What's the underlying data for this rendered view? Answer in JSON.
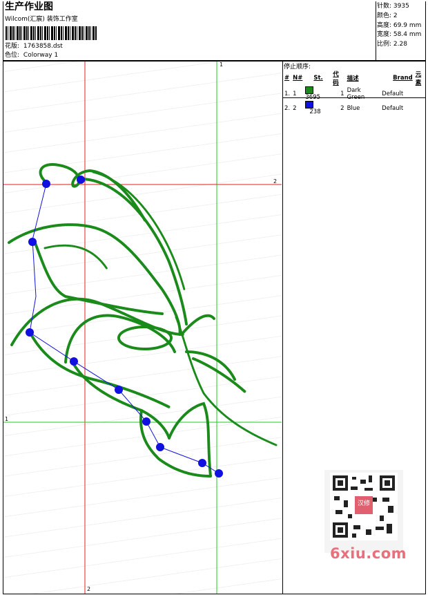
{
  "header": {
    "title": "生产作业图",
    "company": "Wilcom(汇宸) 装饰工作室",
    "design_label": "花版:",
    "design_file": "1763858.dst",
    "colorway_label": "色位:",
    "colorway": "Colorway 1"
  },
  "stats": {
    "stitches_label": "针数:",
    "stitches": "3935",
    "colors_label": "颜色:",
    "colors": "2",
    "height_label": "高度:",
    "height": "69.9 mm",
    "width_label": "宽度:",
    "width": "58.4 mm",
    "ratio_label": "比例:",
    "ratio": "2.28"
  },
  "stop_sequence": {
    "title": "停止顺序:",
    "columns": [
      "#",
      "N#",
      "St.",
      "代码",
      "描述",
      "Brand",
      "元素"
    ],
    "rows": [
      {
        "idx": "1.",
        "n": "1",
        "color": "#1a8a1a",
        "stitches": "3695",
        "code": "1",
        "desc": "Dark Green",
        "brand": "Default"
      },
      {
        "idx": "2.",
        "n": "2",
        "color": "#1010e0",
        "stitches": "238",
        "code": "2",
        "desc": "Blue",
        "brand": "Default"
      }
    ]
  },
  "guides": {
    "v1": "1",
    "h2": "2",
    "h1": "1",
    "v2": "2"
  },
  "watermark": "6xiu.com",
  "qr_badge": "汉修"
}
